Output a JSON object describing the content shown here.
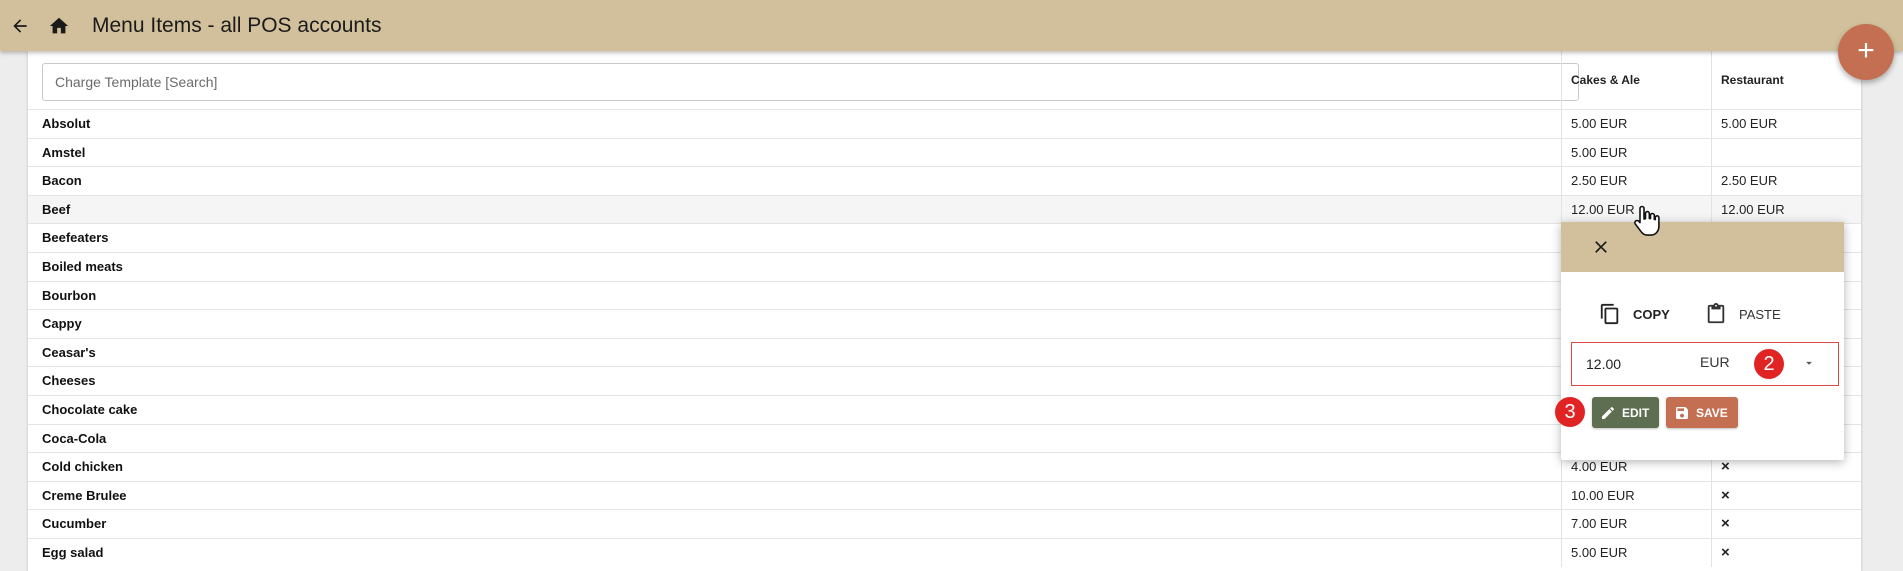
{
  "header": {
    "title": "Menu Items - all POS accounts"
  },
  "fab_label": "+",
  "search": {
    "placeholder": "Charge Template [Search]"
  },
  "columns": [
    "Cakes & Ale",
    "Restaurant"
  ],
  "rows": [
    {
      "name": "Absolut",
      "p1": "5.00 EUR",
      "p2": "5.00 EUR"
    },
    {
      "name": "Amstel",
      "p1": "5.00 EUR",
      "p2": ""
    },
    {
      "name": "Bacon",
      "p1": "2.50 EUR",
      "p2": "2.50 EUR"
    },
    {
      "name": "Beef",
      "p1": "12.00 EUR",
      "p2": "12.00 EUR"
    },
    {
      "name": "Beefeaters",
      "p1": "",
      "p2": ""
    },
    {
      "name": "Boiled meats",
      "p1": "",
      "p2": ""
    },
    {
      "name": "Bourbon",
      "p1": "",
      "p2": ""
    },
    {
      "name": "Cappy",
      "p1": "",
      "p2": ""
    },
    {
      "name": "Ceasar's",
      "p1": "",
      "p2": ""
    },
    {
      "name": "Cheeses",
      "p1": "",
      "p2": ""
    },
    {
      "name": "Chocolate cake",
      "p1": "",
      "p2": ""
    },
    {
      "name": "Coca-Cola",
      "p1": "",
      "p2": ""
    },
    {
      "name": "Cold chicken",
      "p1": "4.00 EUR",
      "p2": "×"
    },
    {
      "name": "Creme Brulee",
      "p1": "10.00 EUR",
      "p2": "×"
    },
    {
      "name": "Cucumber",
      "p1": "7.00 EUR",
      "p2": "×"
    },
    {
      "name": "Egg salad",
      "p1": "5.00 EUR",
      "p2": "×"
    }
  ],
  "popover": {
    "copy_label": "COPY",
    "paste_label": "PASTE",
    "amount": "12.00",
    "currency": "EUR",
    "edit_label": "EDIT",
    "save_label": "SAVE",
    "badge_field": "2",
    "badge_edit": "3"
  },
  "colors": {
    "header": "#d1c09b",
    "fab": "#c46f52",
    "edit_button": "#5e6e50",
    "save_button": "#c46f52",
    "annotation": "#e02424"
  }
}
